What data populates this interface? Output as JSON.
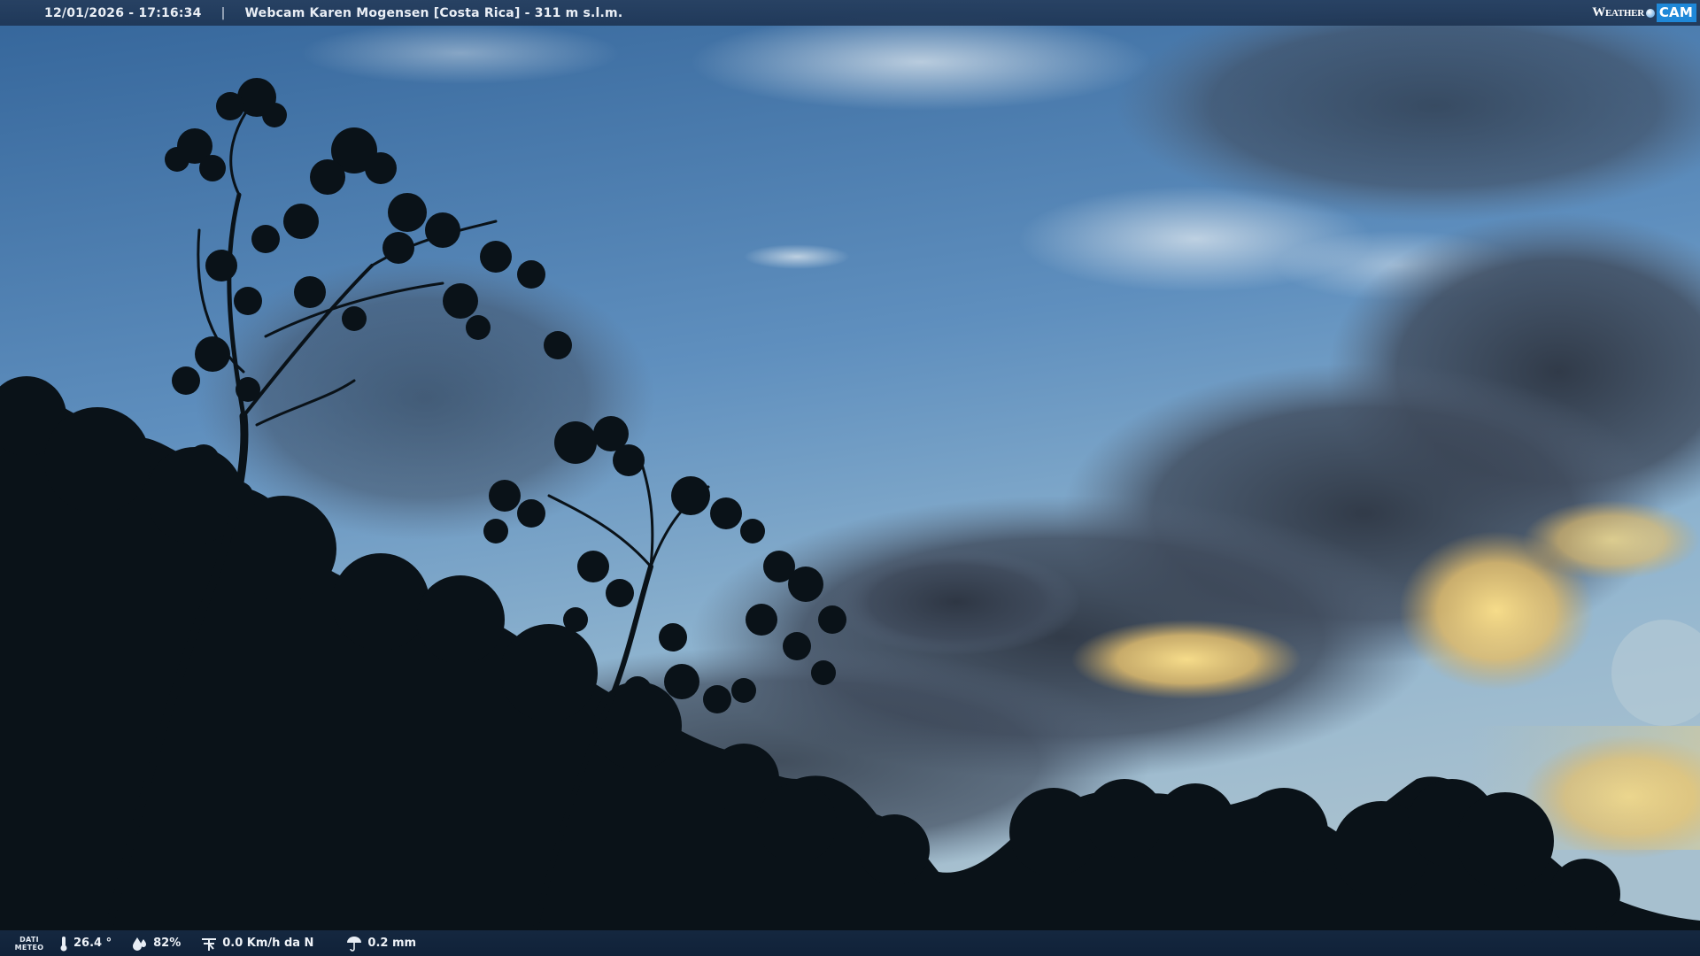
{
  "header": {
    "datetime": "12/01/2026 - 17:16:34",
    "separator": "|",
    "location": "Webcam Karen Mogensen [Costa Rica]  - 311 m s.l.m.",
    "brand_weather": "Weather",
    "brand_cam": "CAM"
  },
  "footer": {
    "dati_line1": "DATI",
    "dati_line2": "METEO",
    "temperature": "26.4 °",
    "humidity": "82%",
    "wind": "0.0 Km/h da N",
    "rain": "0.2 mm",
    "icons": [
      "thermometer-icon",
      "humidity-icon",
      "wind-icon",
      "rain-icon"
    ]
  },
  "colors": {
    "sky_top": "#3f6f9f",
    "sky_mid": "#7ea8c9",
    "cloud_dark": "#3d4656",
    "cloud_glow": "#f2d27a",
    "silhouette": "#0a1218",
    "brand_blue": "#1f88d8"
  }
}
